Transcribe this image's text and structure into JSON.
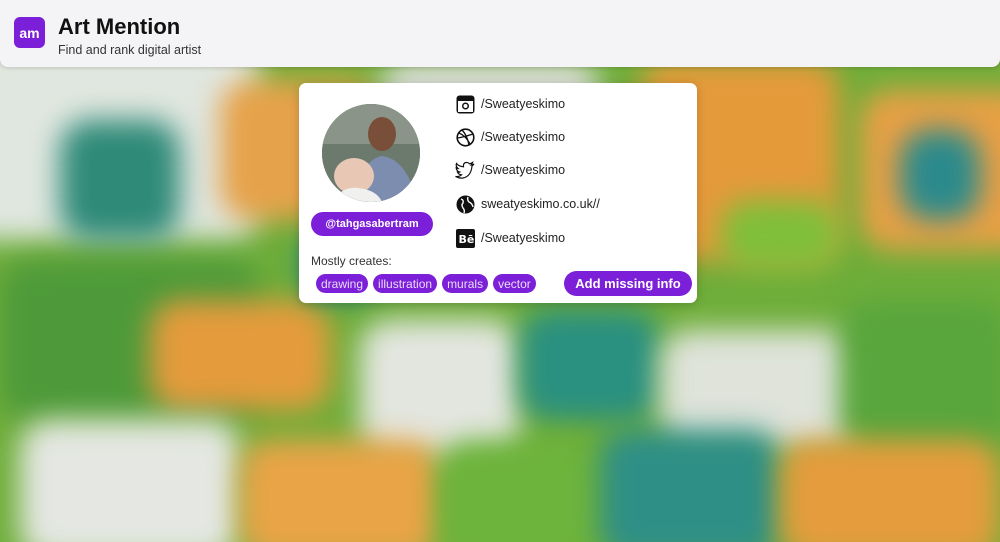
{
  "header": {
    "logo_text": "am",
    "title": "Art Mention",
    "subtitle": "Find and rank digital artist"
  },
  "profile": {
    "handle": "@tahgasabertram",
    "mostly_creates_label": "Mostly creates:",
    "tags": [
      "drawing",
      "illustration",
      "murals",
      "vector"
    ],
    "add_button_label": "Add missing info",
    "socials": [
      {
        "icon": "instagram-icon",
        "text": "/Sweatyeskimo"
      },
      {
        "icon": "dribbble-icon",
        "text": "/Sweatyeskimo"
      },
      {
        "icon": "twitter-icon",
        "text": "/Sweatyeskimo"
      },
      {
        "icon": "globe-icon",
        "text": "sweatyeskimo.co.uk//"
      },
      {
        "icon": "behance-icon",
        "text": "/Sweatyeskimo"
      }
    ]
  },
  "colors": {
    "accent": "#7c1fd8",
    "header_bg": "#f4f4f6"
  }
}
